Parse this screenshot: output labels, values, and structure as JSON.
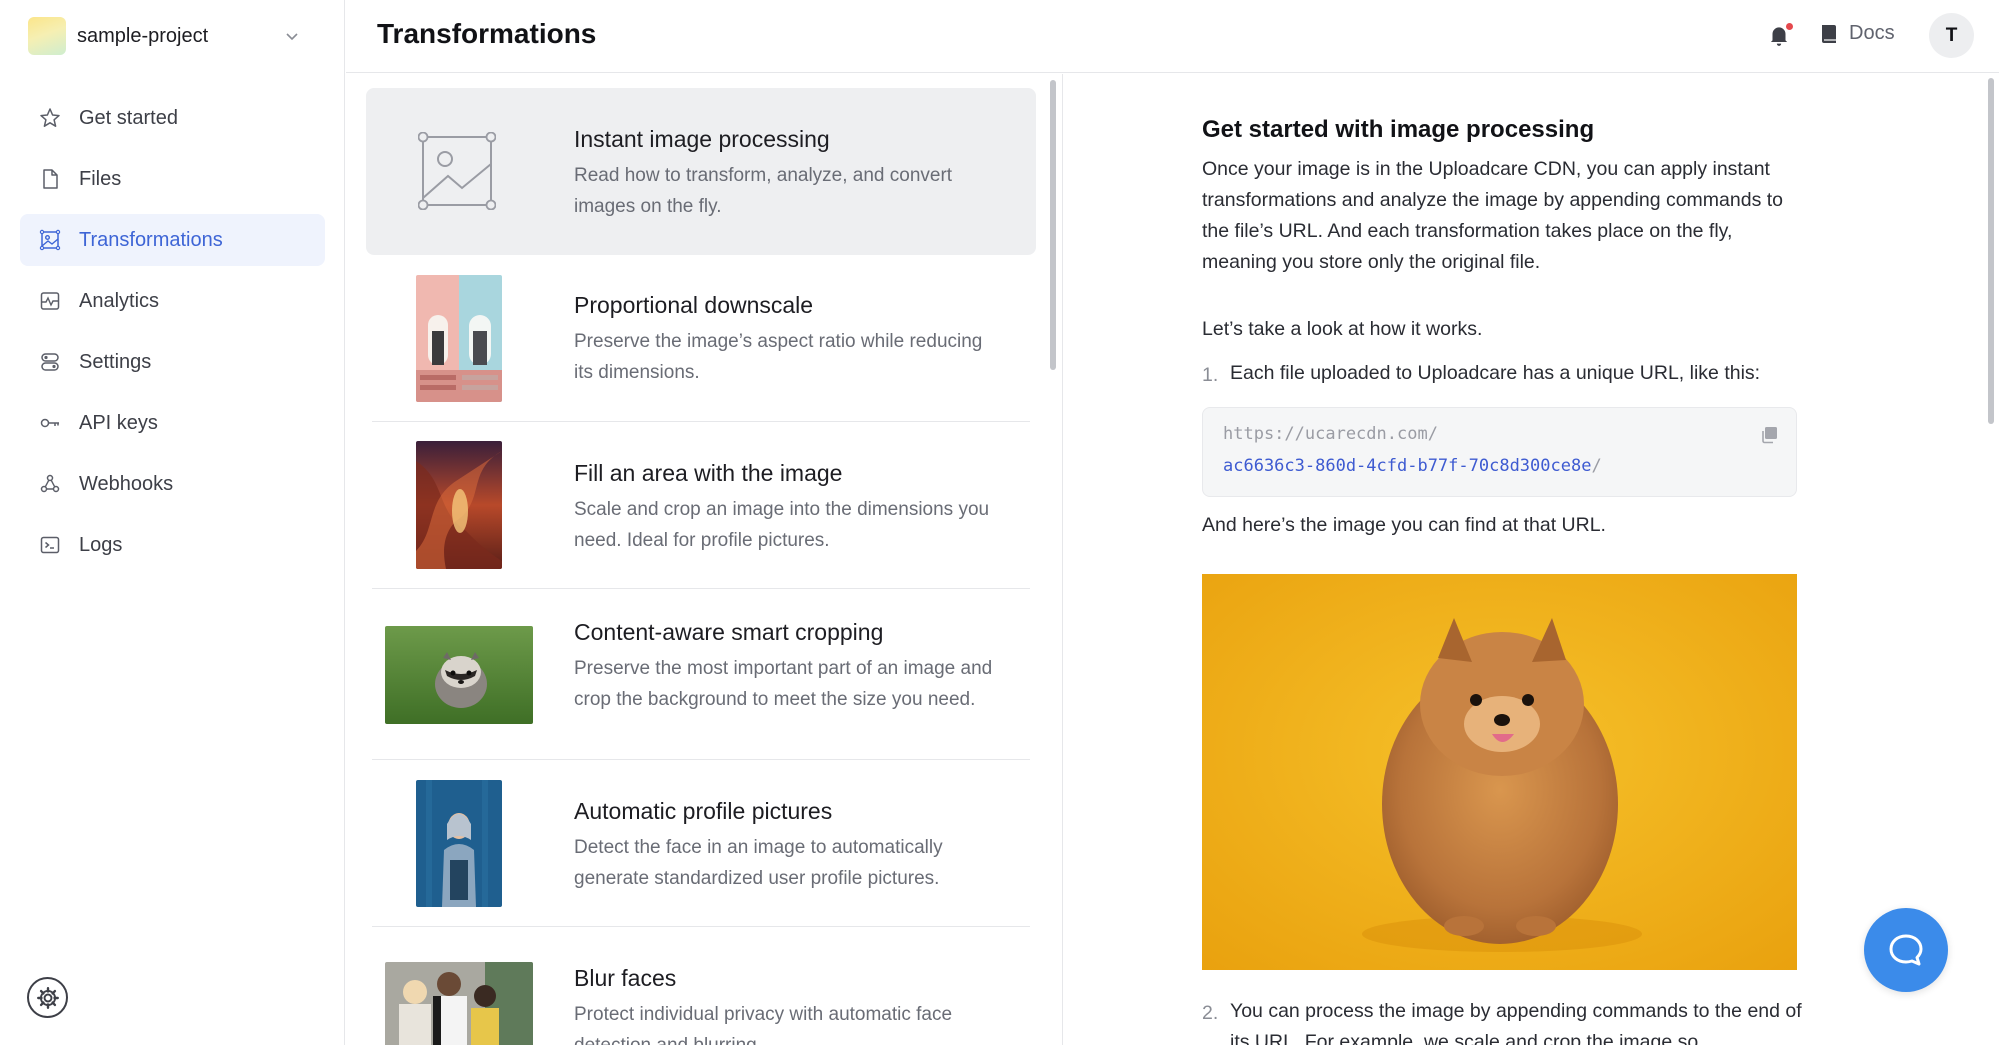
{
  "project": {
    "name": "sample-project"
  },
  "sidebar": {
    "items": [
      {
        "label": "Get started",
        "icon": "star-icon"
      },
      {
        "label": "Files",
        "icon": "file-icon"
      },
      {
        "label": "Transformations",
        "icon": "image-frame-icon",
        "active": true
      },
      {
        "label": "Analytics",
        "icon": "chart-line-icon"
      },
      {
        "label": "Settings",
        "icon": "toggles-icon"
      },
      {
        "label": "API keys",
        "icon": "key-icon"
      },
      {
        "label": "Webhooks",
        "icon": "webhook-icon"
      },
      {
        "label": "Logs",
        "icon": "terminal-icon"
      }
    ]
  },
  "header": {
    "title": "Transformations",
    "docs_label": "Docs",
    "avatar_initial": "T"
  },
  "transformations": [
    {
      "title": "Instant image processing",
      "desc": "Read how to transform, analyze, and convert images on the fly."
    },
    {
      "title": "Proportional downscale",
      "desc": "Preserve the image’s aspect ratio while reducing its dimensions."
    },
    {
      "title": "Fill an area with the image",
      "desc": "Scale and crop an image into the dimensions you need. Ideal for profile pictures."
    },
    {
      "title": "Content-aware smart cropping",
      "desc": "Preserve the most important part of an image and crop the background to meet the size you need."
    },
    {
      "title": "Automatic profile pictures",
      "desc": "Detect the face in an image to automatically generate standardized user profile pictures."
    },
    {
      "title": "Blur faces",
      "desc": "Protect individual privacy with automatic face detection and blurring."
    }
  ],
  "content": {
    "heading": "Get started with image processing",
    "intro": "Once your image is in the Uploadcare CDN, you can apply instant transformations and analyze the image by appending commands to the file’s URL. And each transformation takes place on the fly, meaning you store only the original file.",
    "look": "Let’s take a look at how it works.",
    "step1_num": "1.",
    "step1": "Each file uploaded to Uploadcare has a unique URL, like this:",
    "code_base": "https://ucarecdn.com/",
    "code_uuid": "ac6636c3-860d-4cfd-b77f-70c8d300ce8e",
    "code_slash": "/",
    "here": "And here’s the image you can find at that URL.",
    "step2_num": "2.",
    "step2": "You can process the image by appending commands to the end of its URL. For example, we scale and crop the image so"
  }
}
